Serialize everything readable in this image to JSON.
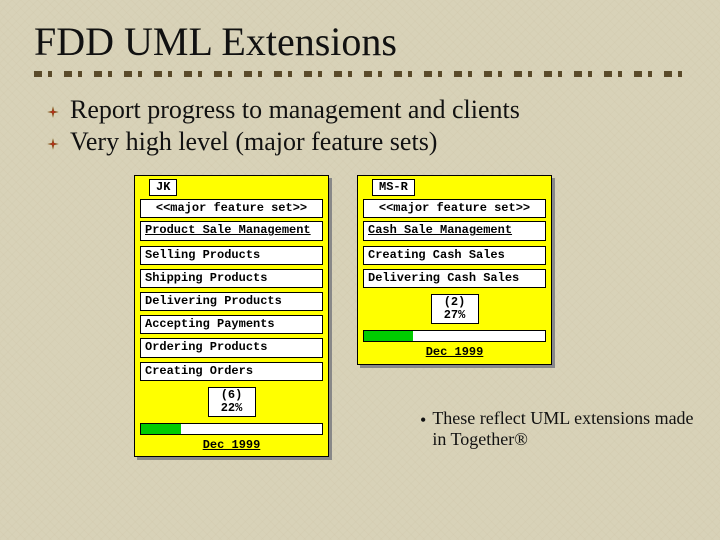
{
  "title": "FDD UML Extensions",
  "bullets": [
    "Report progress to management and clients",
    "Very high level (major feature sets)"
  ],
  "cards": [
    {
      "tab": "JK",
      "stereotype": "<<major feature set>>",
      "name": "Product Sale Management",
      "features": [
        "Selling Products",
        "Shipping Products",
        "Delivering Products",
        "Accepting Payments",
        "Ordering Products",
        "Creating Orders"
      ],
      "count": "(6)",
      "percent": "22%",
      "progress": 22,
      "date": "Dec 1999"
    },
    {
      "tab": "MS-R",
      "stereotype": "<<major feature set>>",
      "name": "Cash Sale Management",
      "features": [
        "Creating Cash Sales",
        "Delivering Cash Sales"
      ],
      "count": "(2)",
      "percent": "27%",
      "progress": 27,
      "date": "Dec 1999"
    }
  ],
  "note": "These reflect UML extensions made in Together®"
}
